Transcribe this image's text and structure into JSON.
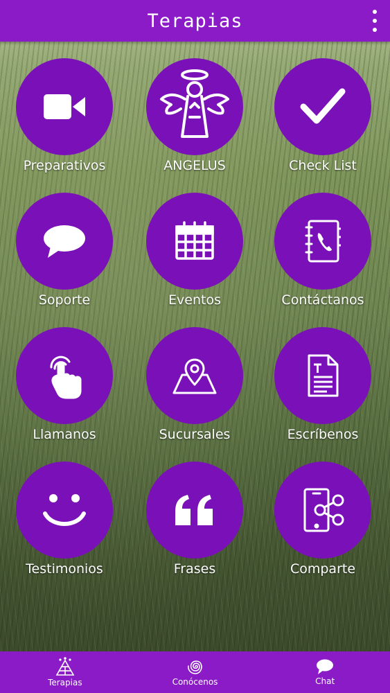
{
  "header": {
    "title": "Terapias",
    "menu_icon": "more-vert-icon"
  },
  "tiles": [
    {
      "label": "Preparativos",
      "icon": "video-camera-icon"
    },
    {
      "label": "ANGELUS",
      "icon": "angel-icon"
    },
    {
      "label": "Check List",
      "icon": "checkmark-icon"
    },
    {
      "label": "Soporte",
      "icon": "chat-bubble-icon"
    },
    {
      "label": "Eventos",
      "icon": "calendar-icon"
    },
    {
      "label": "Contáctanos",
      "icon": "contact-book-icon"
    },
    {
      "label": "Llamanos",
      "icon": "touch-hand-icon"
    },
    {
      "label": "Sucursales",
      "icon": "map-pin-icon"
    },
    {
      "label": "Escríbenos",
      "icon": "document-icon"
    },
    {
      "label": "Testimonios",
      "icon": "smile-icon"
    },
    {
      "label": "Frases",
      "icon": "quote-icon"
    },
    {
      "label": "Comparte",
      "icon": "phone-share-icon"
    }
  ],
  "bottom_nav": [
    {
      "label": "Terapias",
      "icon": "pyramid-icon"
    },
    {
      "label": "Conócenos",
      "icon": "spiral-icon"
    },
    {
      "label": "Chat",
      "icon": "chat-bubble-icon"
    }
  ],
  "colors": {
    "bar": "#8a1bc6",
    "circle": "#7a10b8",
    "text": "#ffffff"
  }
}
